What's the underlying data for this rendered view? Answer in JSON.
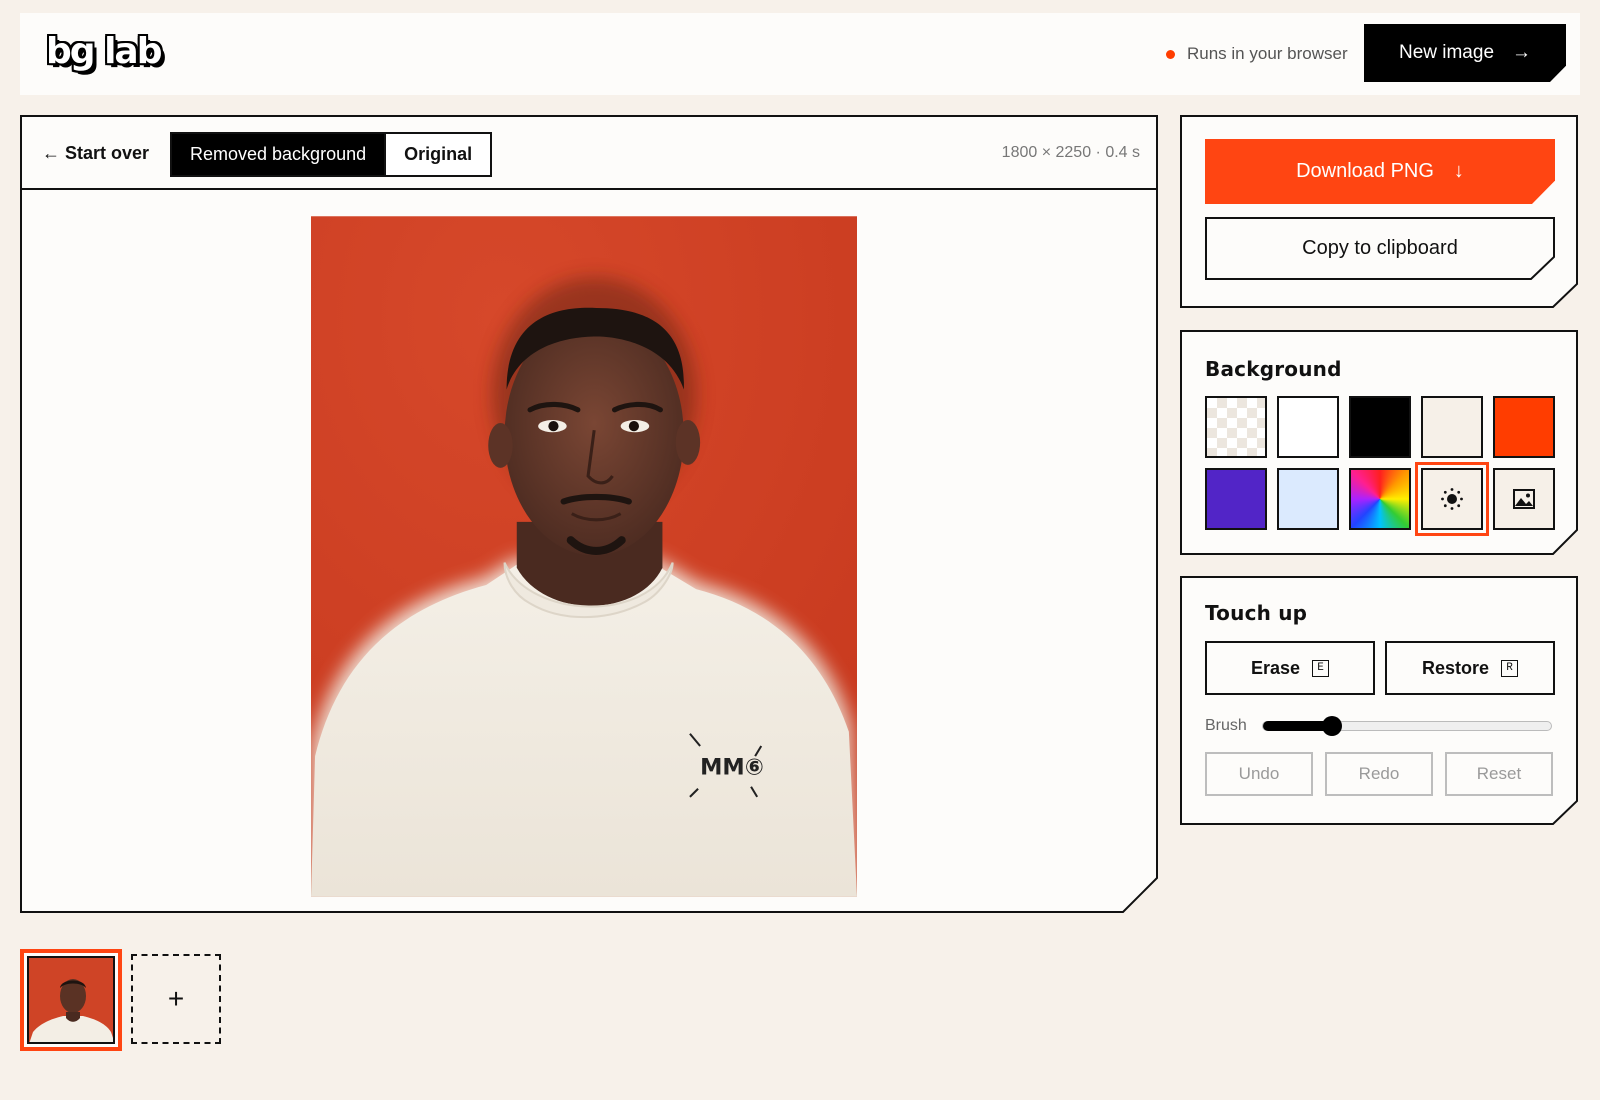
{
  "header": {
    "logo": "bg lab",
    "runs_label": "Runs in your browser",
    "new_image_label": "New image",
    "new_image_arrow": "→"
  },
  "toolbar": {
    "start_over": "← Start over",
    "tabs": [
      {
        "label": "Removed background",
        "active": true
      },
      {
        "label": "Original",
        "active": false
      }
    ],
    "dimensions": "1800 × 2250 · 0.4 s"
  },
  "thumbnails": {
    "add_label": "+"
  },
  "export": {
    "download_label": "Download PNG",
    "download_arrow": "↓",
    "copy_label": "Copy to clipboard"
  },
  "background": {
    "title": "Background",
    "swatches": [
      {
        "name": "transparent",
        "color": "checker"
      },
      {
        "name": "white",
        "color": "#ffffff"
      },
      {
        "name": "black",
        "color": "#000000"
      },
      {
        "name": "cream",
        "color": "#f6f0e8"
      },
      {
        "name": "orange",
        "color": "#ff3d00"
      },
      {
        "name": "purple",
        "color": "#5225c7"
      },
      {
        "name": "light-blue",
        "color": "#dbeafe"
      },
      {
        "name": "rainbow",
        "color": "conic"
      },
      {
        "name": "blur",
        "icon": "sun-icon",
        "selected": true
      },
      {
        "name": "image",
        "icon": "image-icon"
      }
    ]
  },
  "touchup": {
    "title": "Touch up",
    "erase_label": "Erase",
    "erase_key": "E",
    "restore_label": "Restore",
    "restore_key": "R",
    "brush_label": "Brush",
    "brush_value": 0.24,
    "undo_label": "Undo",
    "redo_label": "Redo",
    "reset_label": "Reset"
  },
  "colors": {
    "accent": "#ff4512",
    "page_bg": "#f7f1ea",
    "card_bg": "#fdfcfa",
    "ink": "#111111"
  }
}
